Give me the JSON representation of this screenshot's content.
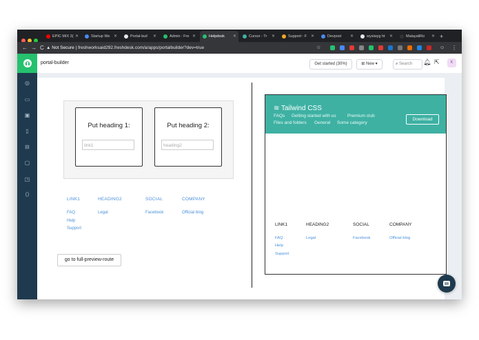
{
  "browser": {
    "tabs": [
      {
        "title": "EPIC MIX 3(",
        "color": "#ff0000"
      },
      {
        "title": "Startup We",
        "color": "#4a8af4"
      },
      {
        "title": "Portal-buil",
        "color": "#e8e8e8"
      },
      {
        "title": "Admin : Fre",
        "color": "#25c16f"
      },
      {
        "title": "Helpdesk",
        "color": "#25c16f"
      },
      {
        "title": "Cursor - Tr",
        "color": "#3eb1a3"
      },
      {
        "title": "Support : F",
        "color": "#f5a623"
      },
      {
        "title": "Devpost",
        "color": "#4a8af4"
      },
      {
        "title": "wysiwyg ht",
        "color": "#e8e8e8"
      },
      {
        "title": "MalayaliRo",
        "color": "#333333"
      }
    ],
    "not_secure": "Not Secure",
    "url": "freshworksaid292.freshdesk.com/a/apps/portalbuilder?dev=true"
  },
  "header": {
    "app_title": "portal-builder",
    "get_started": "Get started (30%)",
    "new_button": "New",
    "search_placeholder": "Search",
    "avatar_initial": "K"
  },
  "editor": {
    "card1": {
      "heading": "Put heading 1:",
      "input_placeholder": "link1"
    },
    "card2": {
      "heading": "Put heading 2:",
      "input_placeholder": "heading2"
    },
    "footer": {
      "columns": [
        {
          "heading": "LINK1",
          "links": [
            "FAQ",
            "Help",
            "Support"
          ]
        },
        {
          "heading": "HEADING2",
          "links": [
            "Legal"
          ]
        },
        {
          "heading": "SOCIAL",
          "links": [
            "Facebook"
          ]
        },
        {
          "heading": "COMPANY",
          "links": [
            "Official blog"
          ]
        }
      ]
    },
    "preview_button": "go to full-preview-route"
  },
  "preview": {
    "brand": "Tailwind CSS",
    "nav_links": [
      "FAQs",
      "Getting started with us",
      "Premium club",
      "Files and folders",
      "General",
      "Some category"
    ],
    "download": "Download",
    "footer": {
      "columns": [
        {
          "heading": "LINK1",
          "links": [
            "FAQ",
            "Help",
            "Support"
          ]
        },
        {
          "heading": "HEADING2",
          "links": [
            "Legal"
          ]
        },
        {
          "heading": "SOCIAL",
          "links": [
            "Facebook"
          ]
        },
        {
          "heading": "COMPANY",
          "links": [
            "Official blog"
          ]
        }
      ]
    }
  },
  "colors": {
    "brand_green": "#25c16f",
    "sidebar": "#1f3a4e",
    "tailwind_teal": "#3eb1a3",
    "link_blue": "#4a90d9"
  }
}
